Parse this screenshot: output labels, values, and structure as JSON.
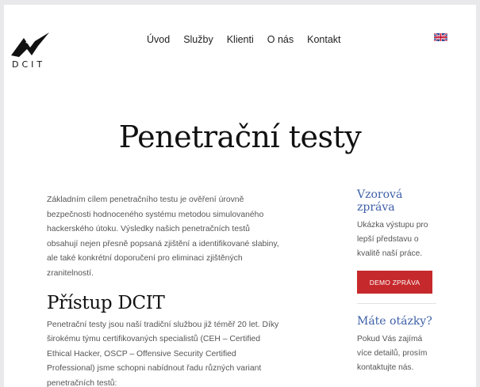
{
  "logo": {
    "text": "DCIT"
  },
  "nav": {
    "items": [
      "Úvod",
      "Služby",
      "Klienti",
      "O nás",
      "Kontakt"
    ]
  },
  "language_icon": "uk-flag-icon",
  "page_title": "Penetrační testy",
  "main": {
    "intro": "Základním cílem penetračního testu je ověření úrovně bezpečnosti hodnoceného systému metodou simulovaného hackerského útoku. Výsledky našich penetračních testů obsahují nejen přesně popsaná zjištění a identifikované slabiny, ale také konkrétní doporučení pro eliminaci zjištěných zranitelností.",
    "section_title": "Přístup DCIT",
    "section_text": "Penetrační testy jsou naší tradiční službou již téměř 20 let. Díky širokému týmu certifikovaných specialistů (CEH – Certified Ethical Hacker, OSCP – Offensive Security Certified Professional) jsme schopni nabídnout řadu různých variant penetračních testů:"
  },
  "sidebar": {
    "sample_title": "Vzorová zpráva",
    "sample_text": "Ukázka výstupu pro lepší představu o kvalitě naší práce.",
    "demo_button": "DEMO ZPRÁVA",
    "questions_title": "Máte otázky?",
    "questions_text": "Pokud Vás zajímá více detailů, prosím kontaktujte nás."
  }
}
